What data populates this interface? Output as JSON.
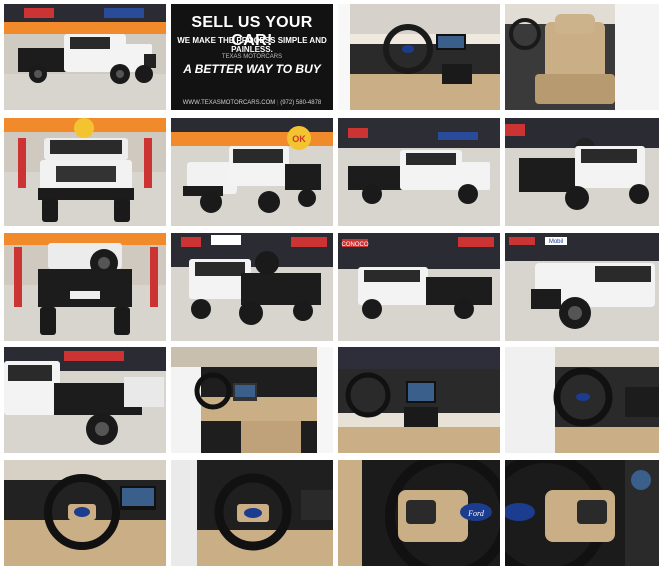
{
  "gallery": {
    "promo": {
      "headline": "SELL US YOUR CAR!",
      "subline": "WE MAKE THE PROCESS SIMPLE AND PAINLESS.",
      "brand": "TEXAS MOTORCARS",
      "slogan": "A BETTER WAY TO BUY",
      "website": "WWW.TEXASMOTORCARS.COM",
      "phone": "(972) 580-4878"
    },
    "signs": {
      "conoco": "CONOCO",
      "mobil": "Mobil",
      "ok": "OK",
      "ford_badge": "Ford"
    }
  },
  "colors": {
    "truck_white": "#f2f2f2",
    "truck_black": "#1c1c1c",
    "floor": "#d9d6d0",
    "wall_orange": "#f08a2a",
    "interior_tan": "#c9ae86",
    "dash_black": "#222222",
    "ford_blue": "#1b3c8f"
  }
}
